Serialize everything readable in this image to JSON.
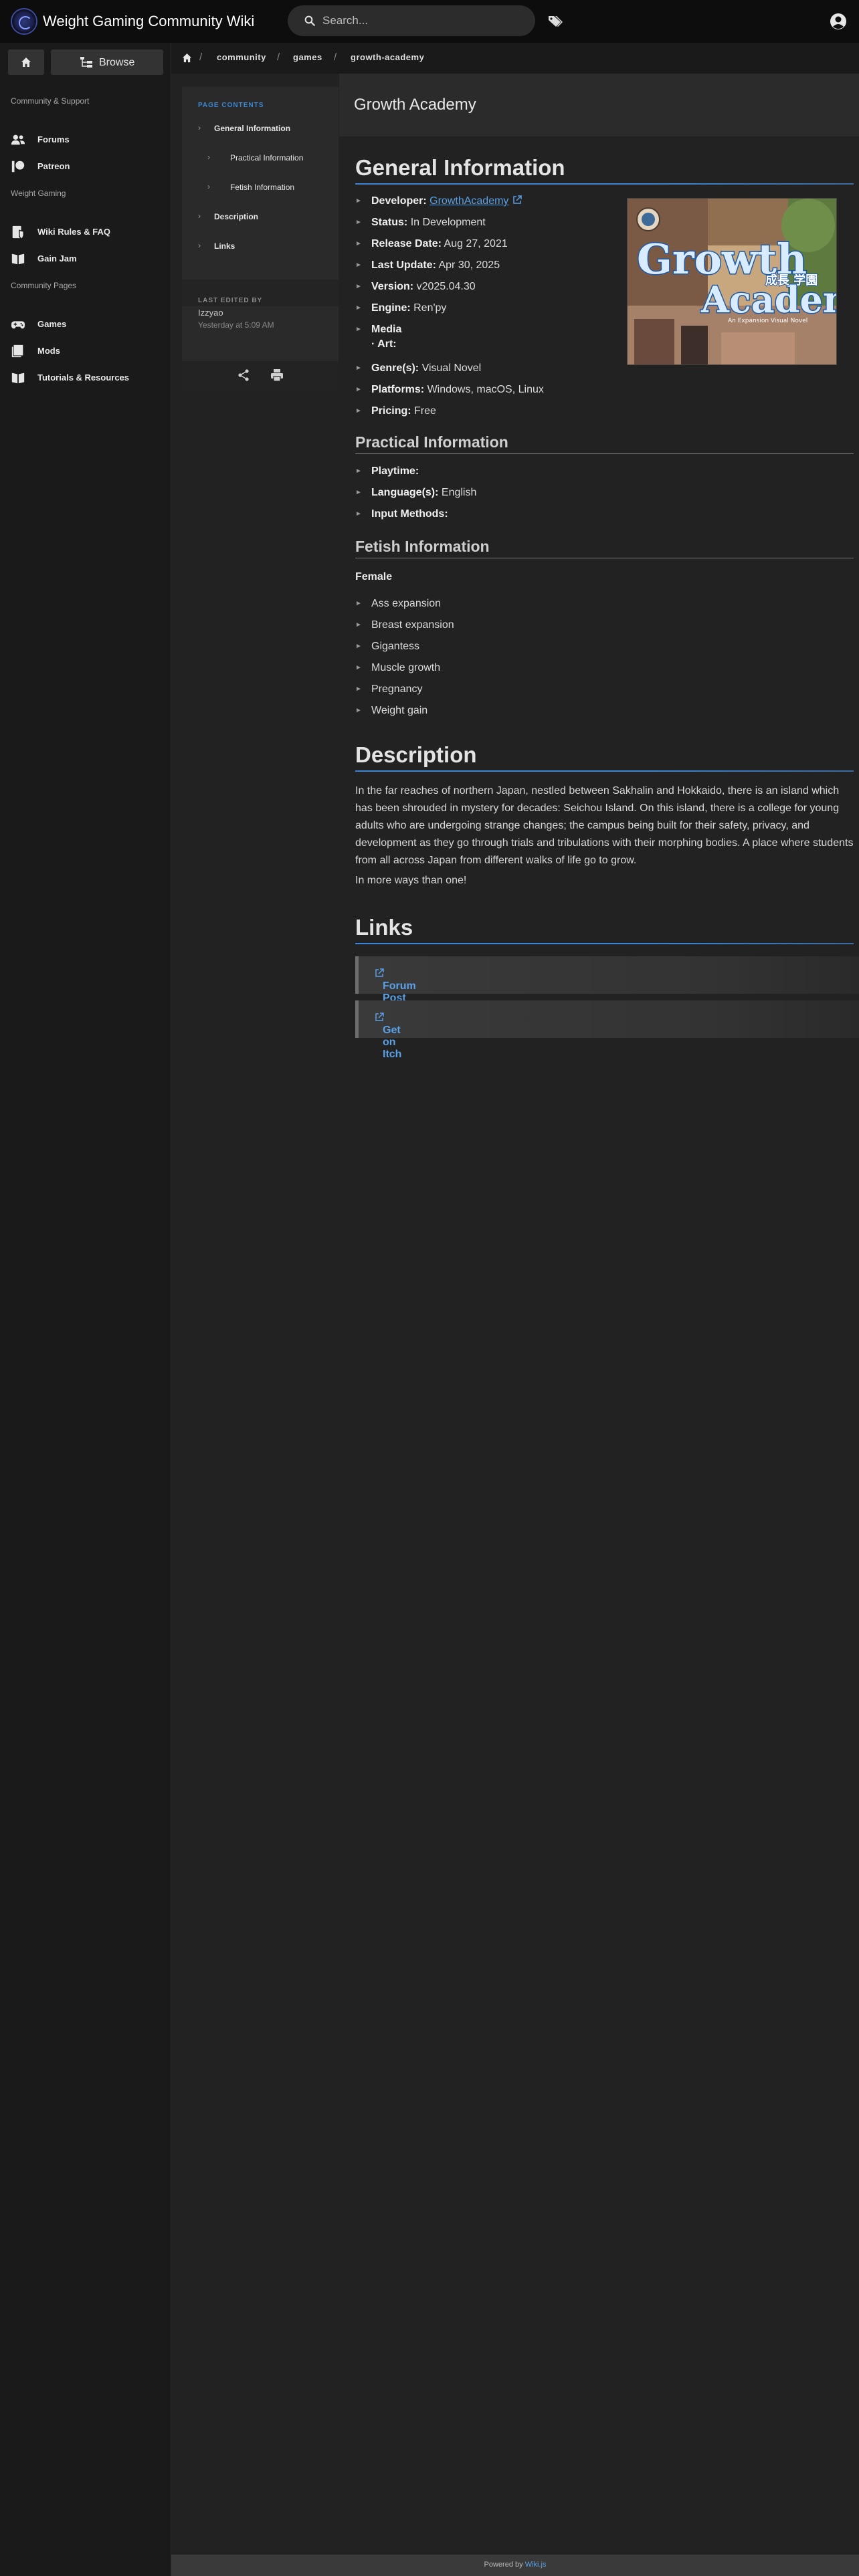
{
  "header": {
    "site_title": "Weight Gaming Community Wiki",
    "search_placeholder": "Search..."
  },
  "sidebar": {
    "browse_label": "Browse",
    "sections": [
      {
        "header": "Community & Support",
        "items": [
          {
            "label": "Forums",
            "icon": "people-icon"
          },
          {
            "label": "Patreon",
            "icon": "patreon-icon"
          }
        ]
      },
      {
        "header": "Weight Gaming",
        "items": [
          {
            "label": "Wiki Rules & FAQ",
            "icon": "book-shield-icon"
          },
          {
            "label": "Gain Jam",
            "icon": "book-open-icon"
          }
        ]
      },
      {
        "header": "Community Pages",
        "items": [
          {
            "label": "Games",
            "icon": "gamepad-icon"
          },
          {
            "label": "Mods",
            "icon": "book-stack-icon"
          },
          {
            "label": "Tutorials & Resources",
            "icon": "book-open-icon"
          }
        ]
      }
    ]
  },
  "breadcrumb": [
    "community",
    "games",
    "growth-academy"
  ],
  "toc": {
    "title": "PAGE CONTENTS",
    "items": [
      {
        "label": "General Information"
      },
      {
        "label": "Practical Information"
      },
      {
        "label": "Fetish Information"
      },
      {
        "label": "Description"
      },
      {
        "label": "Links"
      }
    ],
    "last_edited_label": "LAST EDITED BY",
    "last_edited_by": "Izzyao",
    "last_edited_time": "Yesterday at 5:09 AM"
  },
  "page": {
    "title": "Growth Academy",
    "general": {
      "heading": "General Information",
      "fields": [
        {
          "label": "Developer:",
          "value": "GrowthAcademy"
        },
        {
          "label": "Status:",
          "value": "In Development"
        },
        {
          "label": "Release Date:",
          "value": "Aug 27, 2021"
        },
        {
          "label": "Last Update:",
          "value": "Apr 30, 2025"
        },
        {
          "label": "Version:",
          "value": "v2025.04.30"
        },
        {
          "label": "Engine:",
          "value": "Ren'py"
        },
        {
          "label": "Media",
          "value": ""
        },
        {
          "label": "Genre(s):",
          "value": "Visual Novel"
        },
        {
          "label": "Platforms:",
          "value": "Windows, macOS, Linux"
        },
        {
          "label": "Pricing:",
          "value": "Free"
        }
      ],
      "media_sub": "· Art:",
      "cover_title_1": "Growth",
      "cover_title_2": "Academy",
      "cover_jp": "成長 学園",
      "cover_subtitle": "An Expansion Visual Novel"
    },
    "practical": {
      "heading": "Practical Information",
      "fields": [
        {
          "label": "Playtime:",
          "value": ""
        },
        {
          "label": "Language(s):",
          "value": "English"
        },
        {
          "label": "Input Methods:",
          "value": ""
        }
      ]
    },
    "fetish": {
      "heading": "Fetish Information",
      "group_label": "Female",
      "items": [
        "Ass expansion",
        "Breast expansion",
        "Gigantess",
        "Muscle growth",
        "Pregnancy",
        "Weight gain"
      ]
    },
    "description": {
      "heading": "Description",
      "paragraph1": "In the far reaches of northern Japan, nestled between Sakhalin and Hokkaido, there is an island which has been shrouded in mystery for decades: Seichou Island. On this island, there is a college for young adults who are undergoing strange changes; the campus being built for their safety, privacy, and development as they go through trials and tribulations with their morphing bodies. A place where students from all across Japan from different walks of life go to grow.",
      "paragraph2": "In more ways than one!"
    },
    "links": {
      "heading": "Links",
      "items": [
        "Forum Post",
        "Get on Itch"
      ]
    }
  },
  "footer": {
    "prefix": "Powered by",
    "brand": "Wiki.js"
  },
  "colors": {
    "accent": "#3a86d4",
    "link": "#5aa0e6",
    "background": "#222222"
  }
}
